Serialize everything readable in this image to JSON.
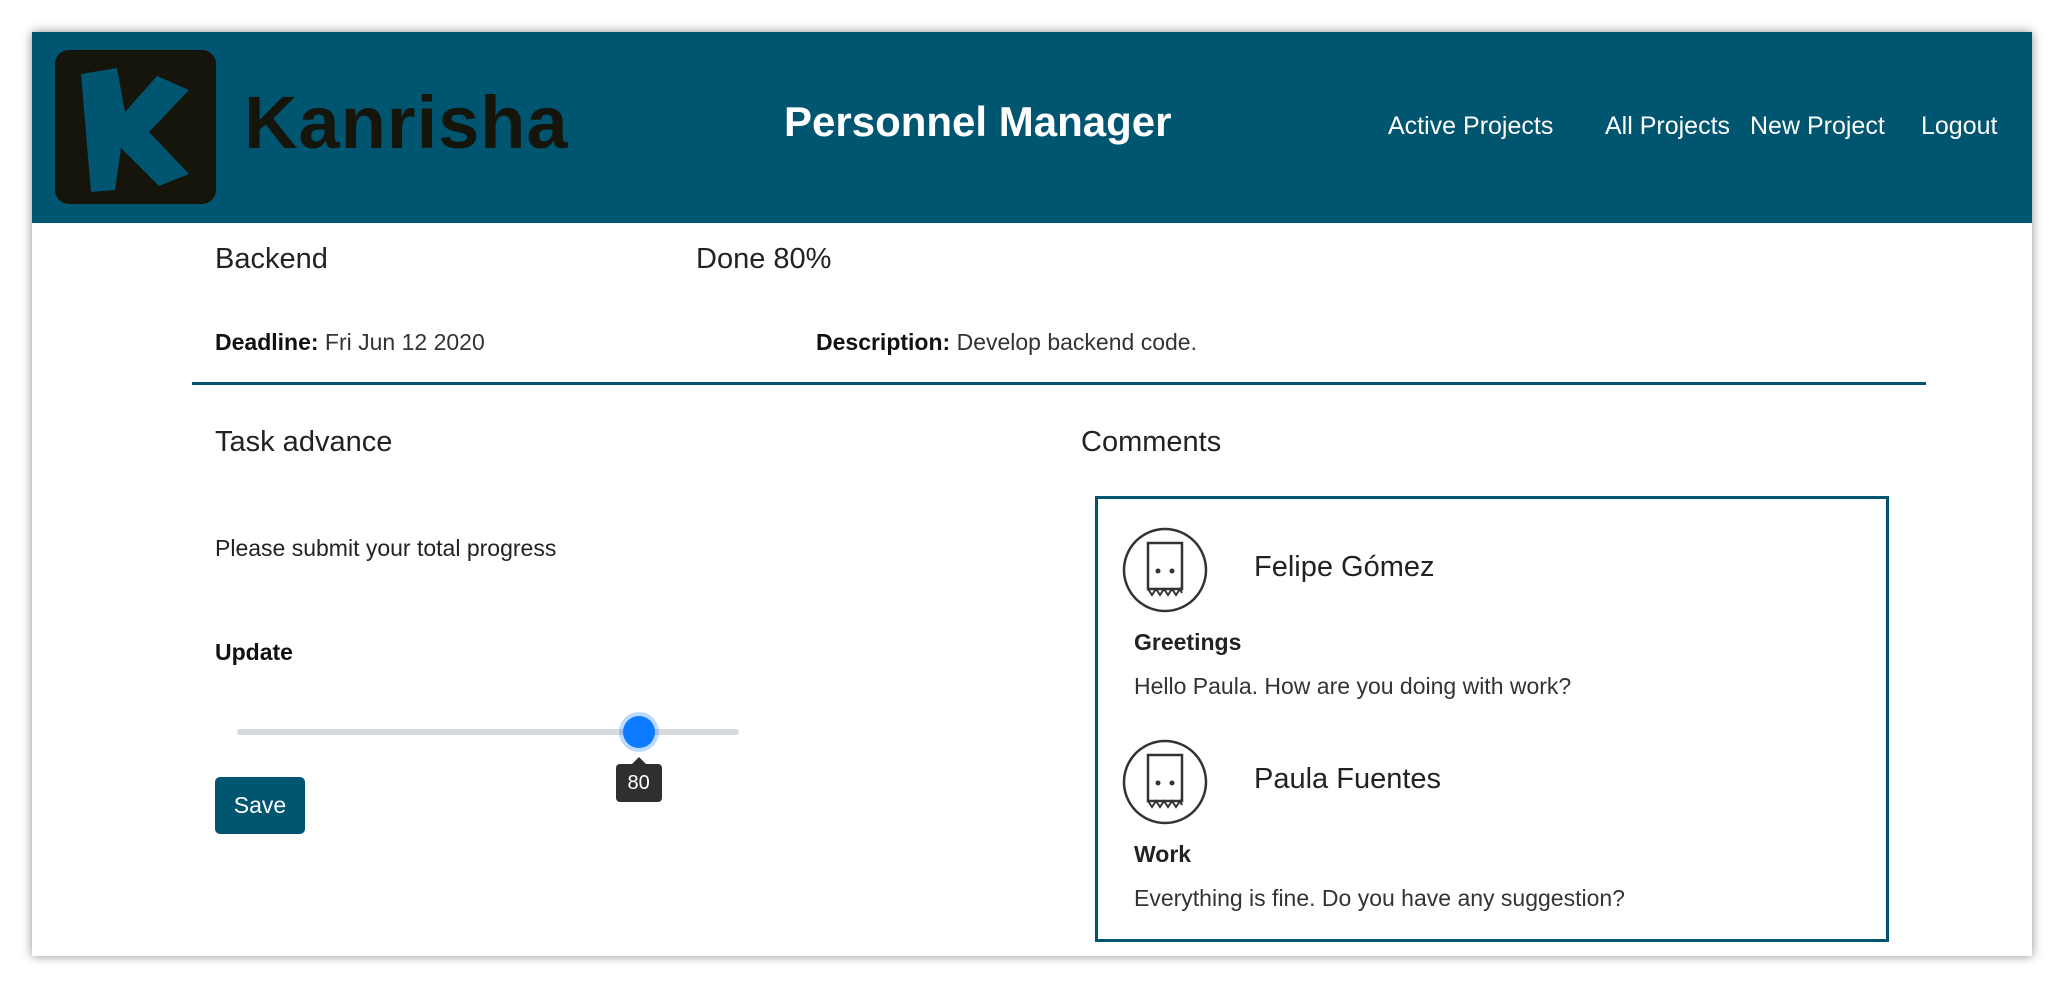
{
  "brand": {
    "name": "Kanrisha",
    "logo_letter": "K",
    "logo_icon": "k-logo-icon"
  },
  "header": {
    "title": "Personnel Manager"
  },
  "nav": {
    "items": [
      {
        "label": "Active Projects"
      },
      {
        "label": "All Projects"
      },
      {
        "label": "New Project"
      },
      {
        "label": "Logout"
      }
    ]
  },
  "task": {
    "name": "Backend",
    "done_label": "Done 80%",
    "deadline_label": "Deadline:",
    "deadline_value": "Fri Jun 12 2020",
    "description_label": "Description:",
    "description_value": "Develop backend code."
  },
  "advance": {
    "title": "Task advance",
    "prompt": "Please submit your total progress",
    "update_label": "Update",
    "slider": {
      "min": 0,
      "max": 100,
      "value": 80,
      "tooltip": "80"
    },
    "save_label": "Save"
  },
  "comments": {
    "title": "Comments",
    "items": [
      {
        "author": "Felipe Gómez",
        "subject": "Greetings",
        "body": "Hello Paula. How are you doing with work?",
        "avatar_icon": "paper-bag-avatar-icon"
      },
      {
        "author": "Paula Fuentes",
        "subject": "Work",
        "body": "Everything is fine. Do you have any suggestion?",
        "avatar_icon": "paper-bag-avatar-icon"
      }
    ]
  },
  "colors": {
    "primary": "#005570",
    "logo_dark": "#15150c",
    "slider_thumb": "#0d7bff",
    "slider_track": "#d6d9dd",
    "tooltip_bg": "#2f2f2f"
  }
}
